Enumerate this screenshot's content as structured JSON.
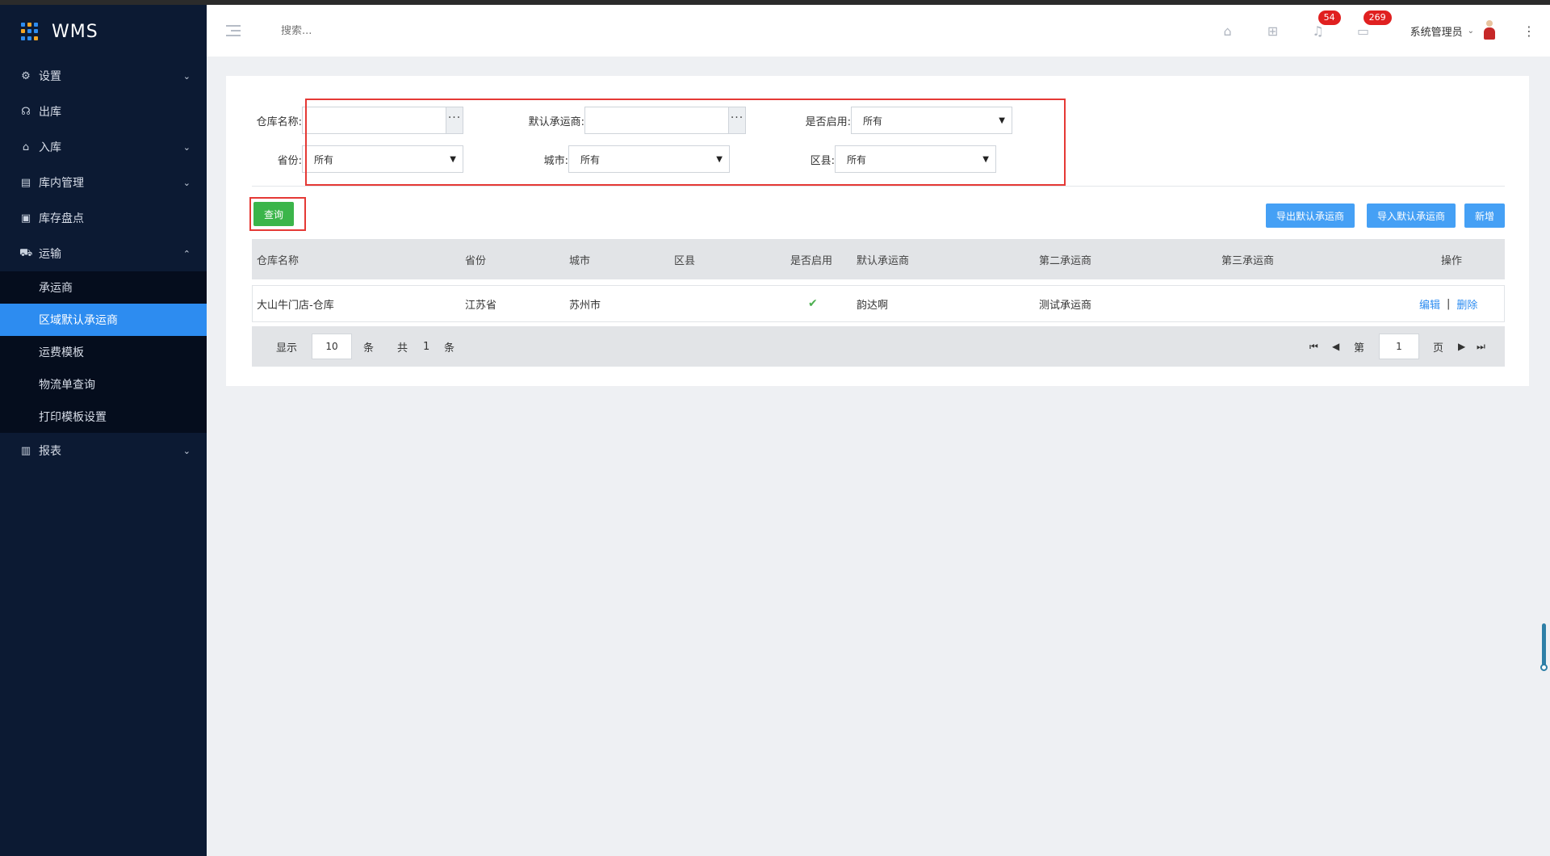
{
  "app": {
    "title": "WMS"
  },
  "sidebar": {
    "items": [
      {
        "label": "设置",
        "icon": "gear-icon"
      },
      {
        "label": "出库",
        "icon": "headset-icon"
      },
      {
        "label": "入库",
        "icon": "home-icon"
      },
      {
        "label": "库内管理",
        "icon": "printer-icon"
      },
      {
        "label": "库存盘点",
        "icon": "inventory-icon"
      },
      {
        "label": "运输",
        "icon": "truck-icon"
      },
      {
        "label": "报表",
        "icon": "bar-chart-icon"
      }
    ],
    "sub_items": [
      {
        "label": "承运商"
      },
      {
        "label": "区域默认承运商",
        "active": true
      },
      {
        "label": "运费模板"
      },
      {
        "label": "物流单查询"
      },
      {
        "label": "打印模板设置"
      }
    ]
  },
  "header": {
    "search_placeholder": "搜索...",
    "notifications_count": "54",
    "messages_count": "269",
    "user_name": "系统管理员"
  },
  "filters": {
    "warehouse_label": "仓库名称:",
    "warehouse_value": "",
    "carrier_label": "默认承运商:",
    "carrier_value": "",
    "enabled_label": "是否启用:",
    "enabled_value": "所有",
    "province_label": "省份:",
    "province_value": "所有",
    "city_label": "城市:",
    "city_value": "所有",
    "district_label": "区县:",
    "district_value": "所有"
  },
  "buttons": {
    "query": "查询",
    "export": "导出默认承运商",
    "import": "导入默认承运商",
    "add": "新增"
  },
  "table": {
    "headers": [
      "仓库名称",
      "省份",
      "城市",
      "区县",
      "是否启用",
      "默认承运商",
      "第二承运商",
      "第三承运商",
      "操作"
    ],
    "rows": [
      {
        "warehouse": "大山牛门店-仓库",
        "province": "江苏省",
        "city": "苏州市",
        "district": "",
        "enabled": "✔",
        "default_carrier": "韵达啊",
        "second_carrier": "测试承运商",
        "third_carrier": "",
        "edit": "编辑",
        "divider": "|",
        "delete": "删除"
      }
    ]
  },
  "pagination": {
    "show_label": "显示",
    "page_size": "10",
    "unit": "条",
    "total_label": "共",
    "total": "1",
    "total_unit": "条",
    "page_label": "第",
    "page": "1",
    "page_unit": "页"
  }
}
